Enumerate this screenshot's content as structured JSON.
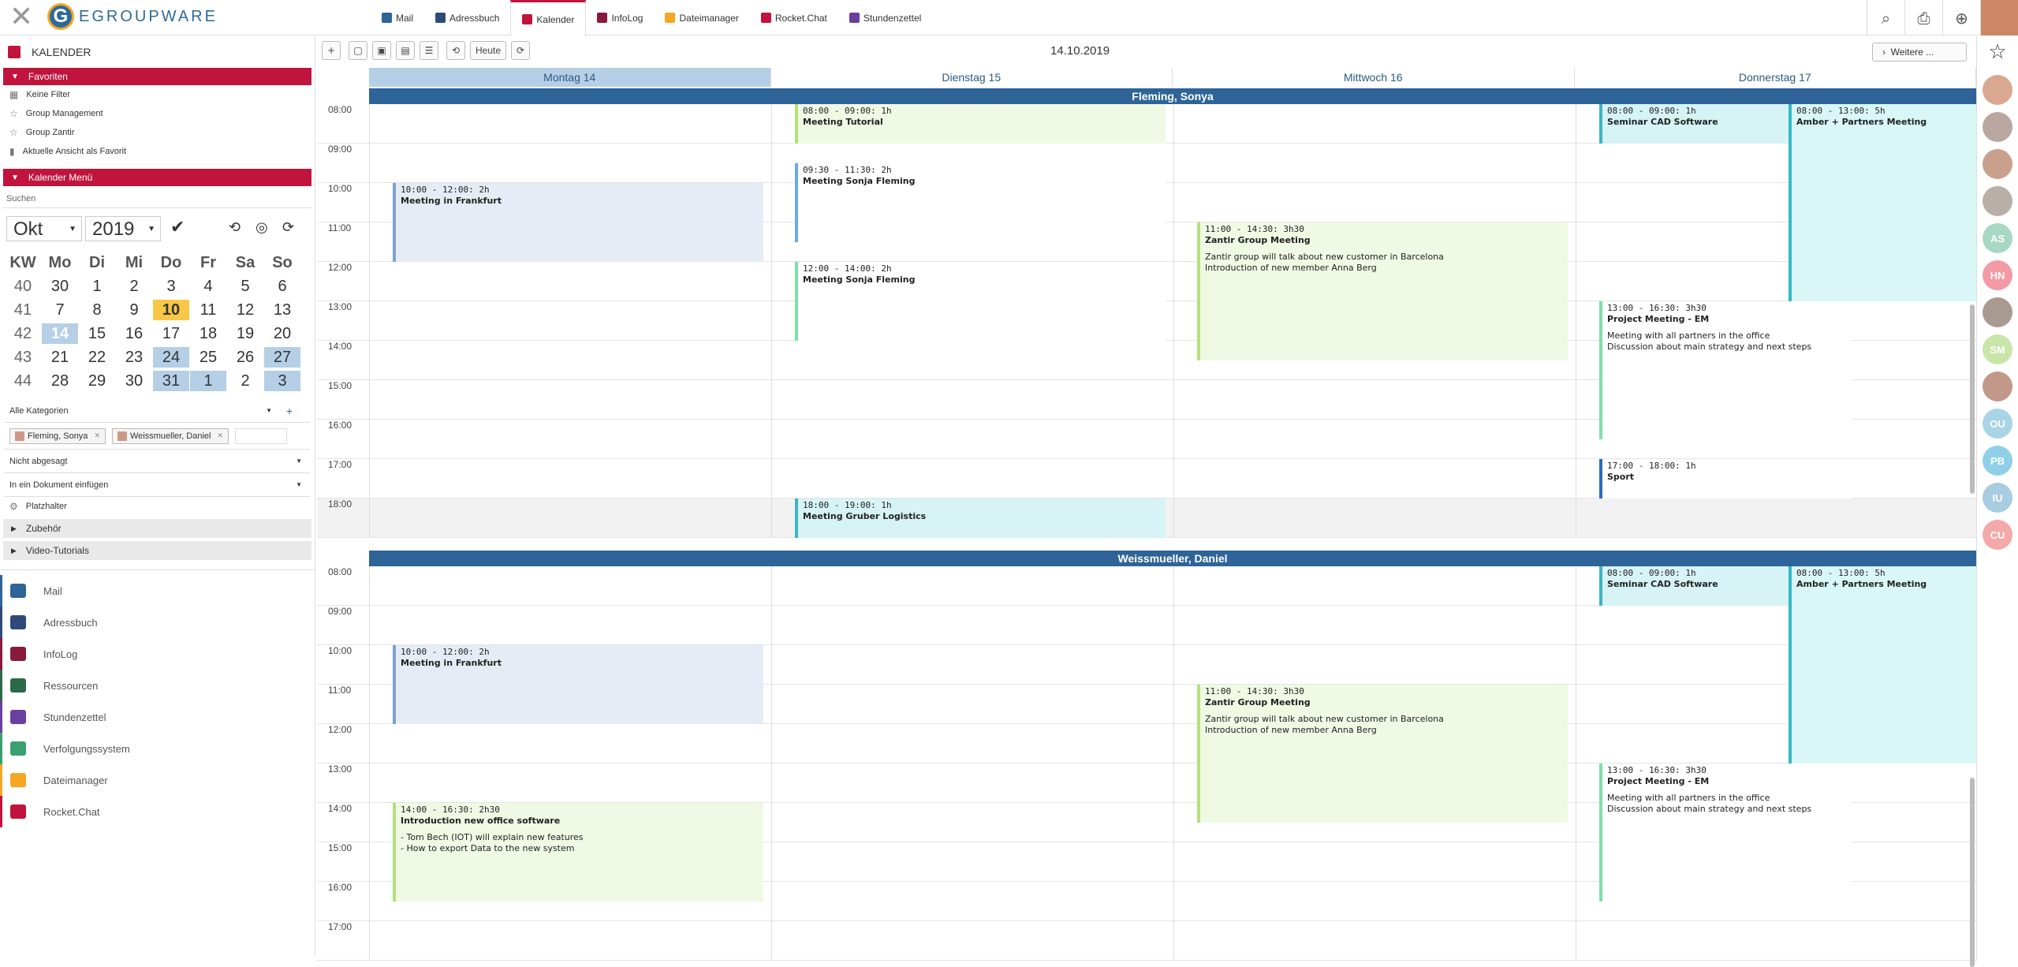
{
  "app": {
    "logo_text": "EGROUPWARE",
    "logo_letter": "G"
  },
  "apptabs": [
    {
      "label": "Mail",
      "color": "#2e6497"
    },
    {
      "label": "Adressbuch",
      "color": "#2e4a7a"
    },
    {
      "label": "Kalender",
      "color": "#c0143c",
      "active": true
    },
    {
      "label": "InfoLog",
      "color": "#8a1a3c"
    },
    {
      "label": "Dateimanager",
      "color": "#f5a623"
    },
    {
      "label": "Rocket.Chat",
      "color": "#c0143c"
    },
    {
      "label": "Stundenzettel",
      "color": "#6a3fa0"
    }
  ],
  "sidebar": {
    "title": "KALENDER",
    "favorites_header": "Favoriten",
    "favorites": [
      "Keine Filter",
      "Group Management",
      "Group Zantir",
      "Aktuelle Ansicht als Favorit"
    ],
    "menu_header": "Kalender Menü",
    "search_placeholder": "Suchen",
    "month": "Okt",
    "year": "2019",
    "weekday_headers": [
      "KW",
      "Mo",
      "Di",
      "Mi",
      "Do",
      "Fr",
      "Sa",
      "So"
    ],
    "weeks": [
      [
        "40",
        "30",
        "1",
        "2",
        "3",
        "4",
        "5",
        "6"
      ],
      [
        "41",
        "7",
        "8",
        "9",
        "10",
        "11",
        "12",
        "13"
      ],
      [
        "42",
        "14",
        "15",
        "16",
        "17",
        "18",
        "19",
        "20"
      ],
      [
        "43",
        "21",
        "22",
        "23",
        "24",
        "25",
        "26",
        "27"
      ],
      [
        "44",
        "28",
        "29",
        "30",
        "31",
        "1",
        "2",
        "3"
      ]
    ],
    "categories": "Alle Kategorien",
    "owners": [
      "Fleming, Sonya",
      "Weissmueller, Daniel"
    ],
    "status": "Nicht abgesagt",
    "document": "In ein Dokument einfügen",
    "placeholder_label": "Platzhalter",
    "collapsibles": [
      "Zubehör",
      "Video-Tutorials"
    ],
    "apps": [
      {
        "label": "Mail",
        "color": "#2e6497"
      },
      {
        "label": "Adressbuch",
        "color": "#2e4a7a"
      },
      {
        "label": "InfoLog",
        "color": "#8a1a3c"
      },
      {
        "label": "Ressourcen",
        "color": "#2a6a4a"
      },
      {
        "label": "Stundenzettel",
        "color": "#6a3fa0"
      },
      {
        "label": "Verfolgungssystem",
        "color": "#3aa070"
      },
      {
        "label": "Dateimanager",
        "color": "#f5a623"
      },
      {
        "label": "Rocket.Chat",
        "color": "#c0143c"
      }
    ]
  },
  "toolbar": {
    "today": "Heute",
    "date": "14.10.2019",
    "more": "Weitere ..."
  },
  "days": [
    "Montag  14",
    "Dienstag  15",
    "Mittwoch  16",
    "Donnerstag  17"
  ],
  "hours_top": [
    "08:00",
    "09:00",
    "10:00",
    "11:00",
    "12:00",
    "13:00",
    "14:00",
    "15:00",
    "16:00",
    "17:00",
    "18:00"
  ],
  "hours_bottom": [
    "08:00",
    "09:00",
    "10:00",
    "11:00",
    "12:00",
    "13:00",
    "14:00",
    "15:00",
    "16:00",
    "17:00"
  ],
  "owners": [
    "Fleming, Sonya",
    "Weissmueller, Daniel"
  ],
  "events_sonya": [
    {
      "time": "08:00 - 09:00: 1h",
      "title": "Meeting Tutorial"
    },
    {
      "time": "09:30 - 11:30: 2h",
      "title": "Meeting Sonja Fleming"
    },
    {
      "time": "10:00 - 12:00: 2h",
      "title": "Meeting in Frankfurt"
    },
    {
      "time": "12:00 - 14:00: 2h",
      "title": "Meeting Sonja Fleming"
    },
    {
      "time": "11:00 - 14:30: 3h30",
      "title": "Zantir Group Meeting",
      "desc": [
        "Zantir group will talk about new customer in Barcelona",
        "Introduction of new member Anna Berg"
      ]
    },
    {
      "time": "08:00 - 09:00: 1h",
      "title": "Seminar CAD Software"
    },
    {
      "time": "08:00 - 13:00: 5h",
      "title": "Amber + Partners Meeting"
    },
    {
      "time": "13:00 - 16:30: 3h30",
      "title": "Project Meeting - EM",
      "desc": [
        "Meeting with all partners in the office",
        "Discussion about main strategy and next steps"
      ]
    },
    {
      "time": "17:00 - 18:00: 1h",
      "title": "Sport"
    },
    {
      "time": "18:00 - 19:00: 1h",
      "title": "Meeting Gruber Logistics"
    }
  ],
  "events_daniel": [
    {
      "time": "08:00 - 09:00: 1h",
      "title": "Seminar CAD Software"
    },
    {
      "time": "08:00 - 13:00: 5h",
      "title": "Amber + Partners Meeting"
    },
    {
      "time": "10:00 - 12:00: 2h",
      "title": "Meeting in Frankfurt"
    },
    {
      "time": "11:00 - 14:30: 3h30",
      "title": "Zantir Group Meeting",
      "desc": [
        "Zantir group will talk about new customer in Barcelona",
        "Introduction of new member Anna Berg"
      ]
    },
    {
      "time": "13:00 - 16:30: 3h30",
      "title": "Project Meeting - EM",
      "desc": [
        "Meeting with all partners in the office",
        "Discussion about main strategy and next steps"
      ]
    },
    {
      "time": "14:00 - 16:30: 2h30",
      "title": "Introduction new office software",
      "desc": [
        "- Tom Bech (IOT) will explain new features",
        "- How to export Data to the new system"
      ]
    }
  ],
  "avatars": [
    {
      "initials": "",
      "color": "#d8a890"
    },
    {
      "initials": "",
      "color": "#b9a7a0"
    },
    {
      "initials": "",
      "color": "#c9a08c"
    },
    {
      "initials": "",
      "color": "#b8b0a8"
    },
    {
      "initials": "AS",
      "color": "#a7d8c3"
    },
    {
      "initials": "HN",
      "color": "#f39aa5"
    },
    {
      "initials": "",
      "color": "#a89a90"
    },
    {
      "initials": "SM",
      "color": "#c8e6a8"
    },
    {
      "initials": "",
      "color": "#c29888"
    },
    {
      "initials": "OU",
      "color": "#a8d4e6"
    },
    {
      "initials": "PB",
      "color": "#8fd0e8"
    },
    {
      "initials": "IU",
      "color": "#a8cce0"
    },
    {
      "initials": "CU",
      "color": "#f5a8a8"
    }
  ]
}
